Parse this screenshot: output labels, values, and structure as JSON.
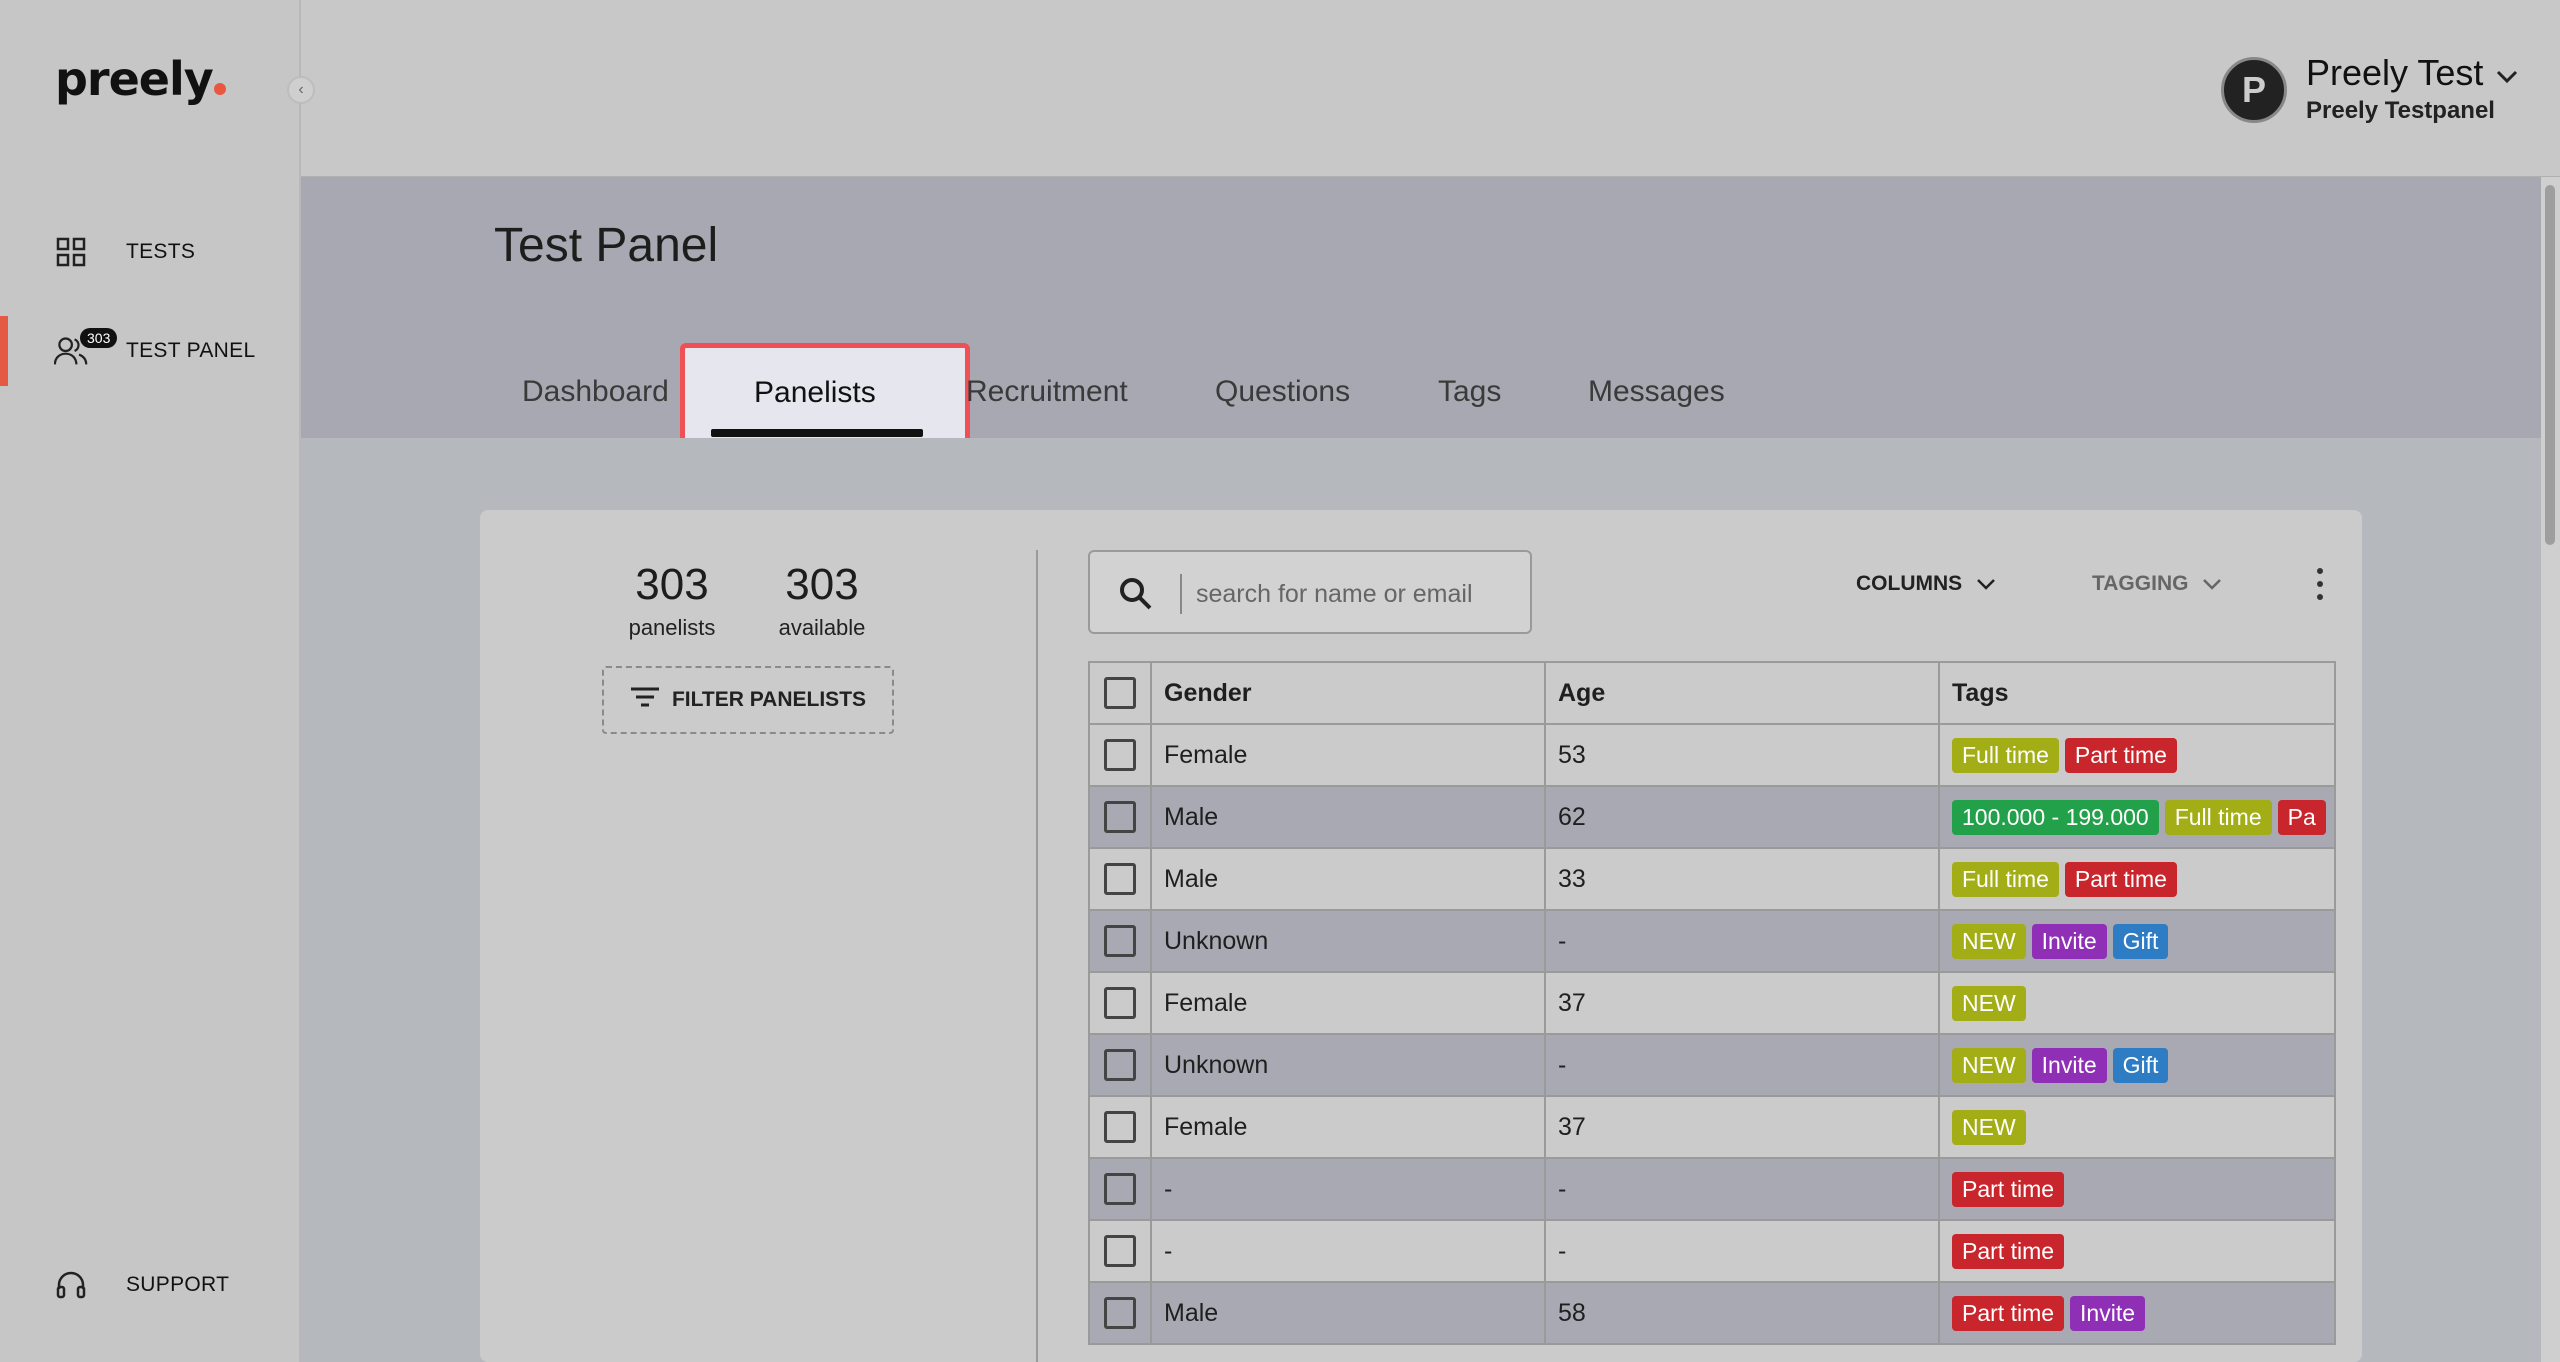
{
  "app": {
    "logo": "preely"
  },
  "sidebar": {
    "items": [
      {
        "label": "TESTS",
        "icon": "grid-icon"
      },
      {
        "label": "TEST PANEL",
        "icon": "users-icon",
        "badge": "303"
      },
      {
        "label": "SUPPORT",
        "icon": "headset-icon"
      }
    ]
  },
  "user": {
    "name": "Preely Test",
    "org": "Preely Testpanel",
    "avatar_letter": "P"
  },
  "page": {
    "title": "Test Panel",
    "tabs": [
      {
        "label": "Dashboard"
      },
      {
        "label": "Panelists",
        "active": true
      },
      {
        "label": "Recruitment"
      },
      {
        "label": "Questions"
      },
      {
        "label": "Tags"
      },
      {
        "label": "Messages"
      }
    ]
  },
  "stats": {
    "panelists_count": "303",
    "panelists_label": "panelists",
    "available_count": "303",
    "available_label": "available",
    "filter_label": "FILTER PANELISTS"
  },
  "toolbar": {
    "search_placeholder": "search for name or email",
    "columns_label": "COLUMNS",
    "tagging_label": "TAGGING"
  },
  "table": {
    "headers": {
      "gender": "Gender",
      "age": "Age",
      "tags": "Tags"
    },
    "rows": [
      {
        "gender": "Female",
        "age": "53",
        "tags": [
          "Full time",
          "Part time"
        ]
      },
      {
        "gender": "Male",
        "age": "62",
        "tags": [
          "100.000 - 199.000",
          "Full time",
          "Pa"
        ]
      },
      {
        "gender": "Male",
        "age": "33",
        "tags": [
          "Full time",
          "Part time"
        ]
      },
      {
        "gender": "Unknown",
        "age": "-",
        "tags": [
          "NEW",
          "Invite",
          "Gift"
        ]
      },
      {
        "gender": "Female",
        "age": "37",
        "tags": [
          "NEW"
        ]
      },
      {
        "gender": "Unknown",
        "age": "-",
        "tags": [
          "NEW",
          "Invite",
          "Gift"
        ]
      },
      {
        "gender": "Female",
        "age": "37",
        "tags": [
          "NEW"
        ]
      },
      {
        "gender": "-",
        "age": "-",
        "tags": [
          "Part time"
        ]
      },
      {
        "gender": "-",
        "age": "-",
        "tags": [
          "Part time"
        ]
      },
      {
        "gender": "Male",
        "age": "58",
        "tags": [
          "Part time",
          "Invite"
        ]
      }
    ]
  },
  "colors": {
    "accent": "#e55a43",
    "highlight_border": "#f05055",
    "tag_full_time": "#a3ad16",
    "tag_part_time": "#c8262c",
    "tag_income": "#22a04a",
    "tag_new": "#a3ad16",
    "tag_invite": "#8e2fb5",
    "tag_gift": "#2e7cc4"
  }
}
